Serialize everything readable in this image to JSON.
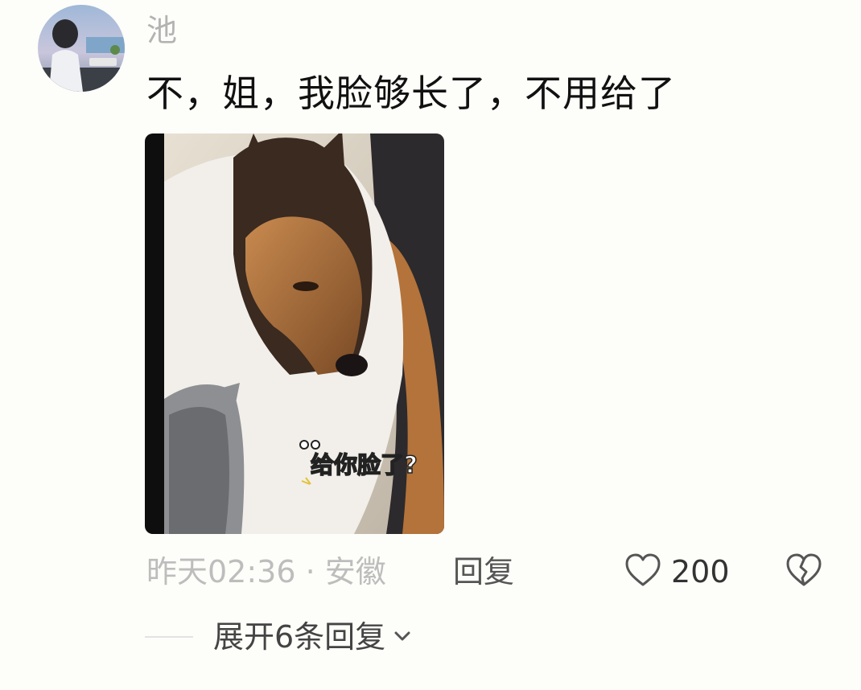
{
  "comment": {
    "username": "池",
    "text": "不，姐，我脸够长了，不用给了",
    "media": {
      "caption": "给你脸了?"
    },
    "meta": {
      "time_location": "昨天02:36 · 安徽",
      "reply_label": "回复",
      "like_count": "200"
    },
    "expand_replies_label": "展开6条回复"
  },
  "icons": {
    "like": "heart-outline-icon",
    "dislike": "broken-heart-icon",
    "expand": "chevron-down-icon"
  },
  "colors": {
    "background": "#fdfdf9",
    "username": "#b3b3b3",
    "meta_text": "#bdbdbd",
    "primary_text": "#111111"
  }
}
